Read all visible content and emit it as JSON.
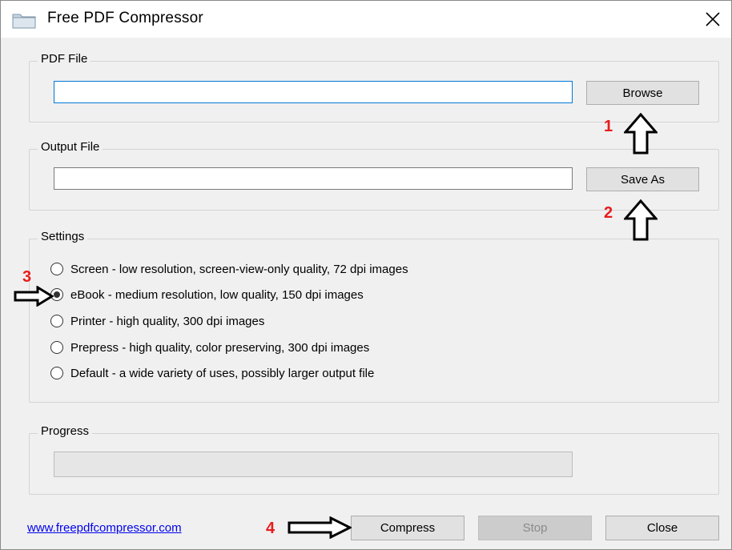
{
  "window": {
    "title": "Free PDF Compressor",
    "icons": {
      "app": "folder-icon",
      "close": "close-icon"
    }
  },
  "pdf_file": {
    "group_label": "PDF File",
    "value": "",
    "browse_label": "Browse"
  },
  "output_file": {
    "group_label": "Output File",
    "value": "",
    "save_as_label": "Save As"
  },
  "settings": {
    "group_label": "Settings",
    "options": [
      {
        "label": "Screen - low resolution, screen-view-only quality, 72 dpi images",
        "selected": false
      },
      {
        "label": "eBook - medium resolution, low quality, 150 dpi images",
        "selected": true
      },
      {
        "label": "Printer - high quality, 300 dpi images",
        "selected": false
      },
      {
        "label": "Prepress - high quality, color preserving, 300 dpi images",
        "selected": false
      },
      {
        "label": "Default - a wide variety of uses, possibly larger output file",
        "selected": false
      }
    ]
  },
  "progress": {
    "group_label": "Progress",
    "percent": 0
  },
  "footer": {
    "link_text": "www.freepdfcompressor.com",
    "compress_label": "Compress",
    "stop_label": "Stop",
    "close_label": "Close"
  },
  "annotations": {
    "marker_1": "1",
    "marker_2": "2",
    "marker_3": "3",
    "marker_4": "4",
    "marker_color": "#e81c1c"
  }
}
